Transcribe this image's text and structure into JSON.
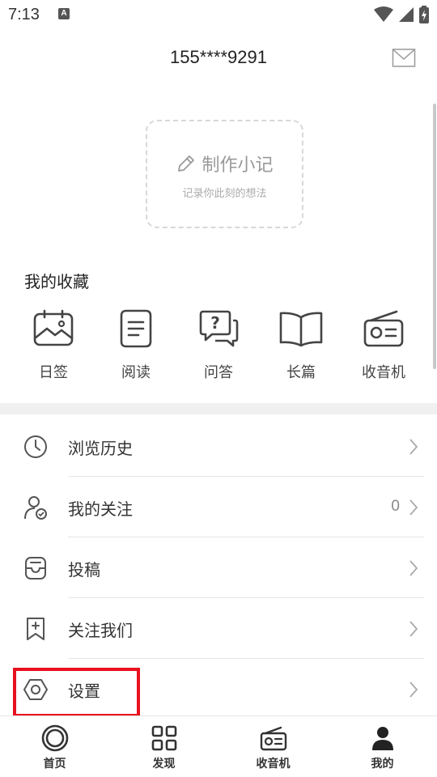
{
  "status_bar": {
    "time": "7:13",
    "notification_badge": "A",
    "icons": [
      "wifi-icon",
      "signal-icon",
      "battery-icon"
    ]
  },
  "header": {
    "title": "155****9291",
    "mail_icon": "mail-icon"
  },
  "note_card": {
    "title": "制作小记",
    "subtitle": "记录你此刻的想法",
    "icon": "pencil-icon"
  },
  "favorites": {
    "title": "我的收藏",
    "items": [
      {
        "label": "日签",
        "icon": "calendar-image-icon"
      },
      {
        "label": "阅读",
        "icon": "document-icon"
      },
      {
        "label": "问答",
        "icon": "question-chat-icon"
      },
      {
        "label": "长篇",
        "icon": "open-book-icon"
      },
      {
        "label": "收音机",
        "icon": "radio-icon"
      }
    ]
  },
  "menu": {
    "items": [
      {
        "label": "浏览历史",
        "icon": "clock-icon",
        "count": ""
      },
      {
        "label": "我的关注",
        "icon": "user-check-icon",
        "count": "0"
      },
      {
        "label": "投稿",
        "icon": "inbox-icon",
        "count": ""
      },
      {
        "label": "关注我们",
        "icon": "bookmark-plus-icon",
        "count": ""
      },
      {
        "label": "设置",
        "icon": "hexagon-settings-icon",
        "count": ""
      }
    ]
  },
  "bottom_nav": {
    "items": [
      {
        "label": "首页",
        "icon": "home-ring-icon"
      },
      {
        "label": "发现",
        "icon": "grid-icon"
      },
      {
        "label": "收音机",
        "icon": "radio-icon"
      },
      {
        "label": "我的",
        "icon": "person-icon",
        "active": true
      }
    ]
  },
  "colors": {
    "highlight": "#e8101f",
    "icon_stroke": "#444444",
    "muted_text": "#999999"
  }
}
